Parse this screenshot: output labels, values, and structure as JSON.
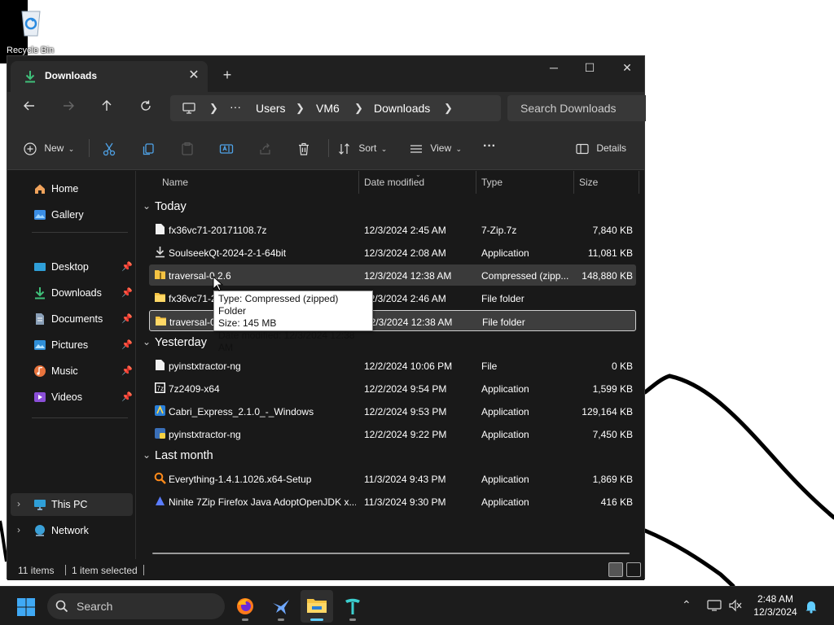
{
  "desktop": {
    "recycle_bin_label": "Recycle Bin"
  },
  "window": {
    "tab_title": "Downloads",
    "tab_close": "✕",
    "new_tab": "+",
    "minimize": "─",
    "maximize": "☐",
    "close": "✕"
  },
  "navbar": {
    "breadcrumb": [
      "Users",
      "VM6",
      "Downloads"
    ],
    "overflow": "···",
    "search_placeholder": "Search Downloads"
  },
  "toolbar": {
    "new_label": "New",
    "sort_label": "Sort",
    "view_label": "View",
    "more": "···",
    "details_label": "Details"
  },
  "sidebar": {
    "items": [
      {
        "label": "Home",
        "icon": "home-icon"
      },
      {
        "label": "Gallery",
        "icon": "gallery-icon"
      },
      {
        "label": "Desktop",
        "icon": "desktop-icon",
        "pinned": true
      },
      {
        "label": "Downloads",
        "icon": "download-icon",
        "pinned": true
      },
      {
        "label": "Documents",
        "icon": "documents-icon",
        "pinned": true
      },
      {
        "label": "Pictures",
        "icon": "pictures-icon",
        "pinned": true
      },
      {
        "label": "Music",
        "icon": "music-icon",
        "pinned": true
      },
      {
        "label": "Videos",
        "icon": "videos-icon",
        "pinned": true
      },
      {
        "label": "This PC",
        "icon": "this-pc-icon"
      },
      {
        "label": "Network",
        "icon": "network-icon"
      }
    ]
  },
  "columns": {
    "name": "Name",
    "date": "Date modified",
    "type": "Type",
    "size": "Size"
  },
  "groups": {
    "today": "Today",
    "yesterday": "Yesterday",
    "last_month": "Last month"
  },
  "files": [
    {
      "name": "fx36vc71-20171108.7z",
      "date": "12/3/2024 2:45 AM",
      "type": "7-Zip.7z",
      "size": "7,840 KB",
      "icon": "archive-file-icon"
    },
    {
      "name": "SoulseekQt-2024-2-1-64bit",
      "date": "12/3/2024 2:08 AM",
      "type": "Application",
      "size": "11,081 KB",
      "icon": "installer-icon"
    },
    {
      "name": "traversal-0.2.6",
      "date": "12/3/2024 12:38 AM",
      "type": "Compressed (zipp...",
      "size": "148,880 KB",
      "icon": "zip-folder-icon"
    },
    {
      "name": "fx36vc71-2",
      "date": "12/3/2024 2:46 AM",
      "type": "File folder",
      "size": "",
      "icon": "folder-icon"
    },
    {
      "name": "traversal-0",
      "date": "12/3/2024 12:38 AM",
      "type": "File folder",
      "size": "",
      "icon": "folder-icon"
    },
    {
      "name": "pyinstxtractor-ng",
      "date": "12/2/2024 10:06 PM",
      "type": "File",
      "size": "0 KB",
      "icon": "file-icon"
    },
    {
      "name": "7z2409-x64",
      "date": "12/2/2024 9:54 PM",
      "type": "Application",
      "size": "1,599 KB",
      "icon": "7zip-icon"
    },
    {
      "name": "Cabri_Express_2.1.0_-_Windows",
      "date": "12/2/2024 9:53 PM",
      "type": "Application",
      "size": "129,164 KB",
      "icon": "cabri-icon"
    },
    {
      "name": "pyinstxtractor-ng",
      "date": "12/2/2024 9:22 PM",
      "type": "Application",
      "size": "7,450 KB",
      "icon": "python-app-icon"
    },
    {
      "name": "Everything-1.4.1.1026.x64-Setup",
      "date": "11/3/2024 9:43 PM",
      "type": "Application",
      "size": "1,869 KB",
      "icon": "everything-icon"
    },
    {
      "name": "Ninite 7Zip Firefox Java AdoptOpenJDK x...",
      "date": "11/3/2024 9:30 PM",
      "type": "Application",
      "size": "416 KB",
      "icon": "ninite-icon"
    }
  ],
  "tooltip": {
    "line1": "Type: Compressed (zipped) Folder",
    "line2": "Size: 145 MB",
    "line3": "Date modified: 12/3/2024 12:38 AM"
  },
  "status": {
    "items": "11 items",
    "selected": "1 item selected"
  },
  "taskbar": {
    "search_label": "Search",
    "time": "2:48 AM",
    "date": "12/3/2024"
  },
  "colors": {
    "accent": "#60cdff",
    "folder": "#f5c342",
    "window_bg": "#191919",
    "chrome_bg": "#2c2c2c"
  }
}
